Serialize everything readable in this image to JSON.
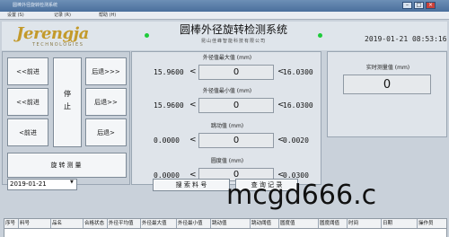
{
  "window": {
    "title": "圆棒外径旋转检测系统"
  },
  "menu": {
    "items": [
      "设置 (S)",
      "记录 (R)",
      "帮助 (H)"
    ]
  },
  "header": {
    "logo_text": "Jerengja",
    "logo_sub": "TECHNOLOGIES",
    "title": "圆棒外径旋转检测系统",
    "subtitle": "昆山佳峰智能科技有限公司",
    "datetime": "2019-01-21 08:53:16"
  },
  "controls": {
    "fast_forward": "<<前进",
    "fast_backward": "后退>>>",
    "forward": "<<前进",
    "stop": "停止",
    "backward": "后退>>",
    "slow_forward": "<前进",
    "slow_backward": "后退>",
    "rotate_measure": "旋转测量"
  },
  "measure": {
    "max_label": "外径值最大值 (mm)",
    "max_value": "0",
    "max_low": "15.9600",
    "max_high": "16.0300",
    "min_label": "外径值最小值 (mm)",
    "min_value": "0",
    "min_low": "15.9600",
    "min_high": "16.0300",
    "runout_label": "跳动值 (mm)",
    "runout_value": "0",
    "runout_low": "0.0000",
    "runout_high": "0.0020",
    "roundness_label": "圆度值 (mm)",
    "roundness_value": "0",
    "roundness_low": "0.0000",
    "roundness_high": "0.0300",
    "lt": "<"
  },
  "realtime": {
    "label": "实时测量值 (mm)",
    "value": "0"
  },
  "search": {
    "date": "2019-01-21",
    "button": "搜 索 料 号",
    "button2": "查 询 记 录"
  },
  "table": {
    "columns": [
      "序号",
      "料号",
      "品名",
      "合格状态",
      "外径平均值",
      "外径最大值",
      "外径最小值",
      "跳动值",
      "跳动阈值",
      "圆度值",
      "圆度阈值",
      "时间",
      "日期",
      "操作员"
    ]
  },
  "watermark": "mcgd666.c"
}
